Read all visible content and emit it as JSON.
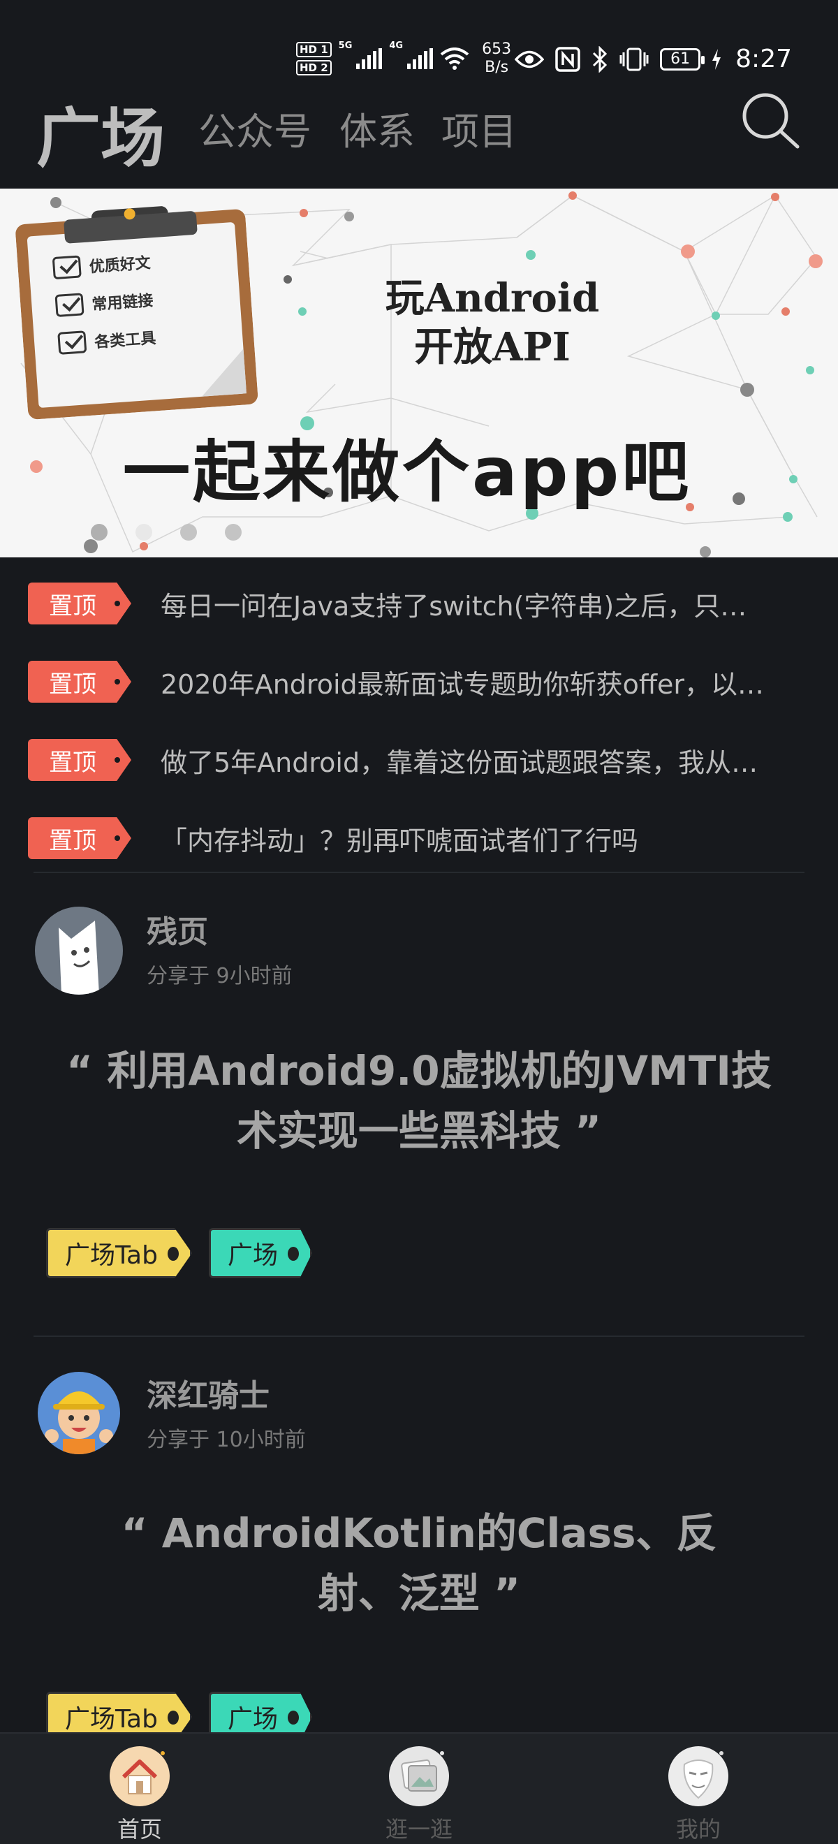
{
  "status_bar": {
    "sim1": "HD 1",
    "sim2": "HD 2",
    "net1": "5G",
    "net2": "4G",
    "speed_value": "653",
    "speed_unit": "B/s",
    "battery": "61",
    "time": "8:27"
  },
  "top_nav": {
    "tabs": [
      "广场",
      "公众号",
      "体系",
      "项目"
    ],
    "active_index": 0,
    "search_icon": "search-icon"
  },
  "banner": {
    "clipboard_items": [
      "优质好文",
      "常用链接",
      "各类工具"
    ],
    "title_line1": "玩Android",
    "title_line2": "开放API",
    "slogan": "一起来做个app吧",
    "page_count": 4,
    "current_page": 1
  },
  "pinned": {
    "tag": "置顶",
    "items": [
      "每日一问在Java支持了switch(字符串)之后，只…",
      "2020年Android最新面试专题助你斩获offer，以…",
      "做了5年Android，靠着这份面试题跟答案，我从…",
      "「内存抖动」？别再吓唬面试者们了行吗"
    ]
  },
  "articles": [
    {
      "author": "残页",
      "time": "分享于 9小时前",
      "title": "“ 利用Android9.0虚拟机的JVMTI技术实现一些黑科技 ”",
      "tags": [
        "广场Tab",
        "广场"
      ]
    },
    {
      "author": "深红骑士",
      "time": "分享于 10小时前",
      "title": "“ AndroidKotlin的Class、反射、泛型 ”",
      "tags": [
        "广场Tab",
        "广场"
      ]
    }
  ],
  "bottom_nav": {
    "items": [
      "首页",
      "逛一逛",
      "我的"
    ],
    "active_index": 0
  },
  "colors": {
    "background": "#17191d",
    "pin_tag": "#f06252",
    "tag_yellow": "#f2d55a",
    "tag_teal": "#3bd8b7"
  }
}
